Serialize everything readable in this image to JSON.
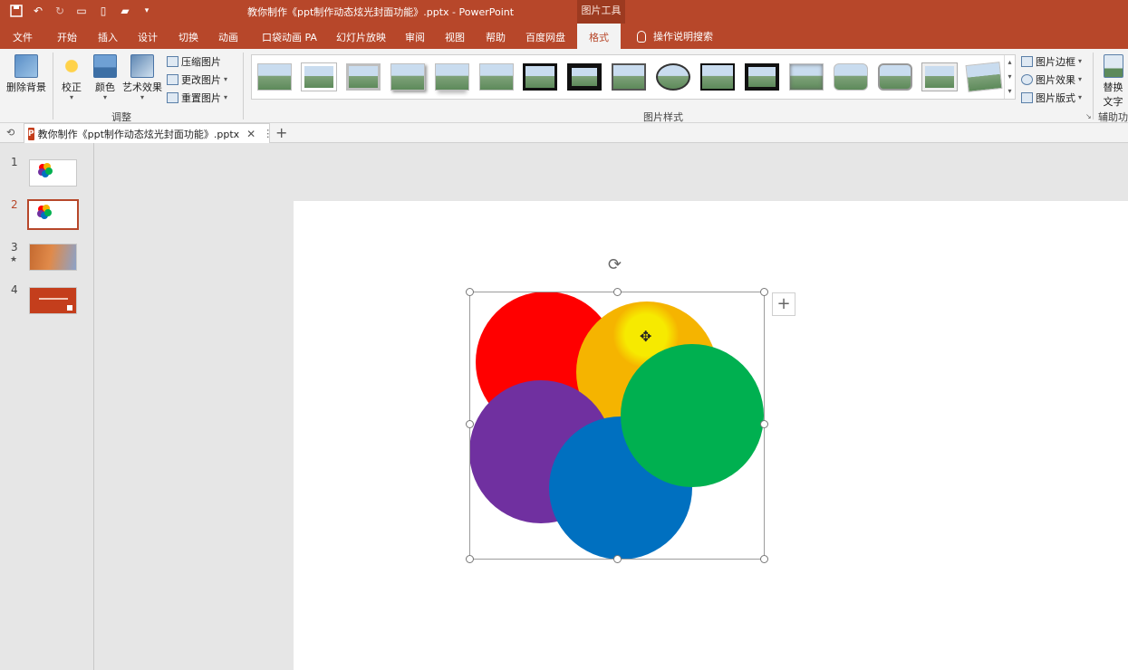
{
  "window": {
    "doc_title": "教你制作《ppt制作动态炫光封面功能》.pptx - PowerPoint",
    "context_tab_group": "图片工具"
  },
  "ribbon_tabs": [
    "文件",
    "开始",
    "插入",
    "设计",
    "切换",
    "动画",
    "口袋动画 PA",
    "幻灯片放映",
    "审阅",
    "视图",
    "帮助",
    "百度网盘",
    "格式"
  ],
  "active_tab": "格式",
  "tell_me": "操作说明搜索",
  "ribbon": {
    "remove_bg": "删除背景",
    "corrections": "校正",
    "color": "颜色",
    "artistic": "艺术效果",
    "compress": "压缩图片",
    "change": "更改图片",
    "reset": "重置图片",
    "adjust_group": "调整",
    "styles_group": "图片样式",
    "border": "图片边框",
    "effects": "图片效果",
    "layout": "图片版式",
    "alt_text_line1": "替换",
    "alt_text_line2": "文字",
    "accessibility_group": "辅助功"
  },
  "document_tab": {
    "name": "教你制作《ppt制作动态炫光封面功能》.pptx",
    "ppt_badge": "P"
  },
  "slides": [
    {
      "number": "1",
      "marker": ""
    },
    {
      "number": "2",
      "marker": ""
    },
    {
      "number": "3",
      "marker": "★"
    },
    {
      "number": "4",
      "marker": ""
    }
  ],
  "colors": {
    "accent": "#b7472a",
    "red": "#ff0000",
    "orange": "#f5b400",
    "purple": "#7030a0",
    "blue": "#0070c0",
    "green": "#00b050"
  }
}
